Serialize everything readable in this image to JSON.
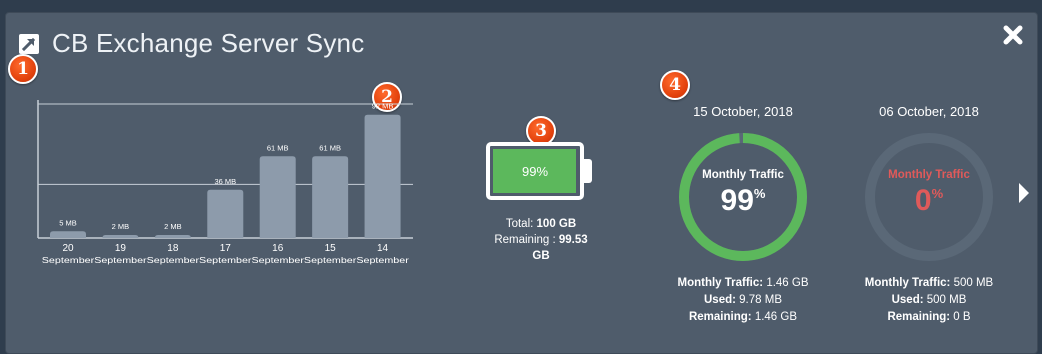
{
  "window": {
    "title": "CB Exchange Server Sync",
    "open_icon": "external-link-icon",
    "close_icon": "close-icon"
  },
  "callouts": [
    "1",
    "2",
    "3",
    "4"
  ],
  "chart_data": {
    "type": "bar",
    "categories": [
      "20 September",
      "19 September",
      "18 September",
      "17 September",
      "16 September",
      "15 September",
      "14 September"
    ],
    "day_labels": [
      "20",
      "19",
      "18",
      "17",
      "16",
      "15",
      "14"
    ],
    "month_labels": [
      "September",
      "September",
      "September",
      "September",
      "September",
      "September",
      "September"
    ],
    "values": [
      5,
      2,
      2,
      36,
      61,
      61,
      92
    ],
    "value_labels": [
      "5 MB",
      "2 MB",
      "2 MB",
      "36 MB",
      "61 MB",
      "61 MB",
      "92 MB"
    ],
    "unit": "MB",
    "ylim": [
      0,
      100
    ],
    "gridlines": [
      40,
      100
    ],
    "bar_color": "#8d9bab",
    "grid_color": "#c7cfd7"
  },
  "storage": {
    "percent_label": "99%",
    "fill_fraction": 0.99,
    "total_label": "Total:",
    "total_value": "100 GB",
    "remaining_label": "Remaining :",
    "remaining_value": "99.53",
    "remaining_unit": "GB",
    "fill_color": "#5cb85c"
  },
  "traffic_cards": [
    {
      "date": "15 October, 2018",
      "title": "Monthly Traffic",
      "value": "99",
      "value_unit": "%",
      "ring_fraction": 0.99,
      "ring_color": "#5cb85c",
      "text_color": "#ffffff",
      "monthly_label": "Monthly Traffic:",
      "monthly_value": "1.46 GB",
      "used_label": "Used:",
      "used_value": "9.78 MB",
      "remaining_label": "Remaining:",
      "remaining_value": "1.46 GB"
    },
    {
      "date": "06 October, 2018",
      "title": "Monthly Traffic",
      "value": "0",
      "value_unit": "%",
      "ring_fraction": 0,
      "ring_color": "#5a6877",
      "text_color": "#e05a5a",
      "monthly_label": "Monthly Traffic:",
      "monthly_value": "500 MB",
      "used_label": "Used:",
      "used_value": "500 MB",
      "remaining_label": "Remaining:",
      "remaining_value": "0 B"
    }
  ],
  "nav": {
    "next_icon": "chevron-right-icon"
  }
}
